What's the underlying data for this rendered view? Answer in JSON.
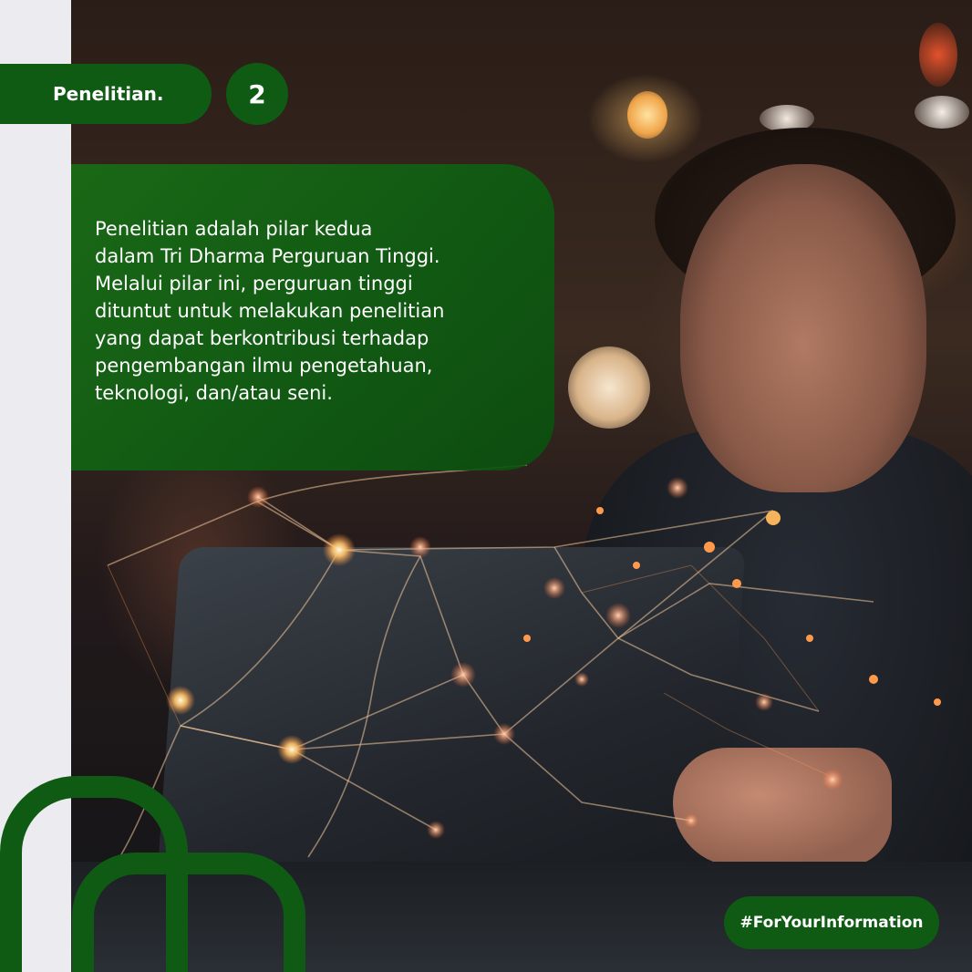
{
  "header": {
    "section_label": "Penelitian.",
    "page_number": "2"
  },
  "panel": {
    "lines": [
      "Penelitian adalah pilar kedua",
      "dalam Tri Dharma Perguruan Tinggi.",
      "Melalui pilar ini, perguruan tinggi",
      "dituntut untuk melakukan penelitian",
      "yang dapat berkontribusi terhadap",
      "pengembangan ilmu pengetahuan,",
      "teknologi, dan/atau seni."
    ]
  },
  "footer": {
    "hashtag": "#ForYourInformation"
  },
  "colors": {
    "brand_green": "#0f5b14",
    "background": "#ecebf0"
  }
}
